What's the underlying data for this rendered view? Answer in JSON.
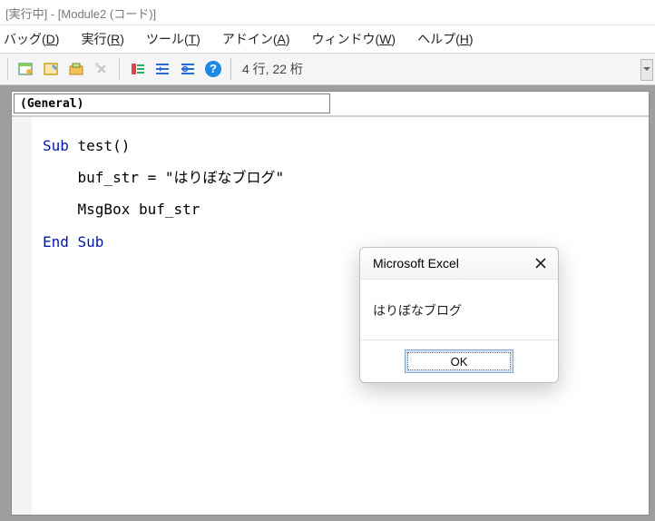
{
  "title": " [実行中] - [Module2 (コード)]",
  "menu": [
    {
      "label": "バッグ",
      "key": "D"
    },
    {
      "label": "実行",
      "key": "R"
    },
    {
      "label": "ツール",
      "key": "T"
    },
    {
      "label": "アドイン",
      "key": "A"
    },
    {
      "label": "ウィンドウ",
      "key": "W"
    },
    {
      "label": "ヘルプ",
      "key": "H"
    }
  ],
  "toolbar": {
    "position": "4 行, 22 桁"
  },
  "dropdown": {
    "object": "(General)"
  },
  "code": {
    "l1a": "Sub",
    "l1b": " test()",
    "l2": "    buf_str = \"はりぼなブログ\"",
    "l3": "    MsgBox buf_str",
    "l4": "End Sub"
  },
  "dialog": {
    "title": "Microsoft Excel",
    "message": "はりぼなブログ",
    "ok": "OK"
  }
}
